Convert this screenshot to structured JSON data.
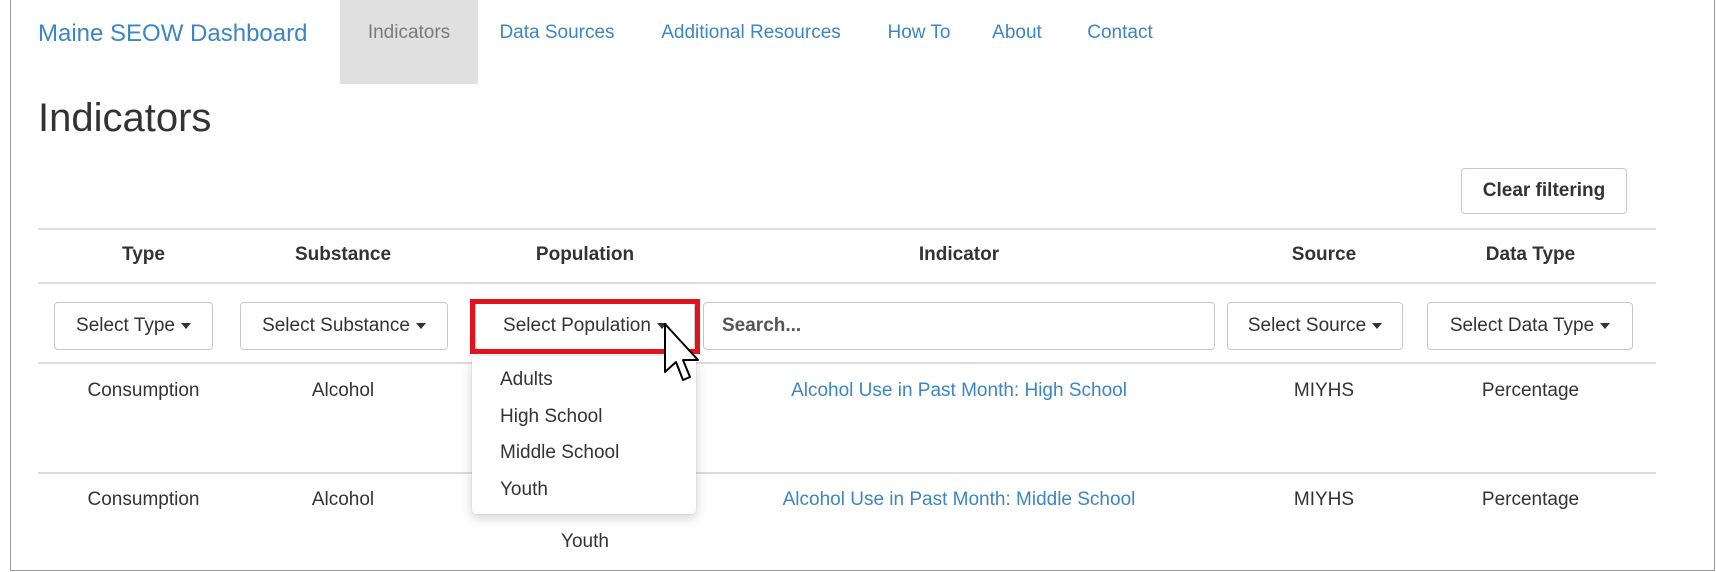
{
  "nav": {
    "brand": "Maine SEOW Dashboard",
    "items": [
      "Indicators",
      "Data Sources",
      "Additional Resources",
      "How To",
      "About",
      "Contact"
    ],
    "active": "Indicators"
  },
  "page": {
    "title": "Indicators"
  },
  "toolbar": {
    "clear_label": "Clear filtering"
  },
  "table": {
    "headers": [
      "Type",
      "Substance",
      "Population",
      "Indicator",
      "Source",
      "Data Type"
    ],
    "filters": {
      "type": "Select Type",
      "substance": "Select Substance",
      "population": "Select Population",
      "search_placeholder": "Search...",
      "source": "Select Source",
      "data_type": "Select Data Type"
    },
    "rows": [
      {
        "type": "Consumption",
        "substance": "Alcohol",
        "population": "",
        "indicator": "Alcohol Use in Past Month: High School",
        "source": "MIYHS",
        "data_type": "Percentage"
      },
      {
        "type": "Consumption",
        "substance": "Alcohol",
        "population": "Youth",
        "indicator": "Alcohol Use in Past Month: Middle School",
        "source": "MIYHS",
        "data_type": "Percentage"
      }
    ]
  },
  "population_menu": {
    "options": [
      "Adults",
      "High School",
      "Middle School",
      "Youth"
    ]
  },
  "colors": {
    "link": "#3a86c8",
    "highlight": "#e0141e",
    "active_nav_bg": "#e0e0e0"
  }
}
